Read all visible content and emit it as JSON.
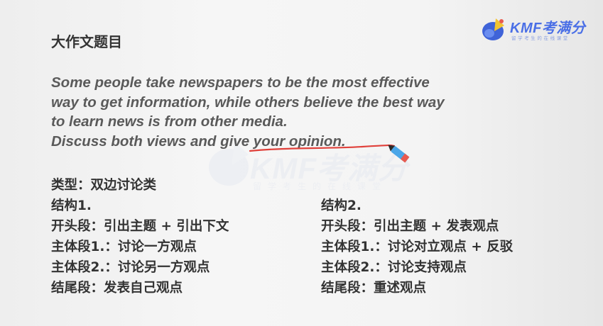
{
  "brand": {
    "name": "KMF考满分",
    "tagline": "留学考生的在线课堂"
  },
  "slide": {
    "title": "大作文题目",
    "prompt_lines": [
      "Some people take newspapers to be the most effective",
      "way to get information, while others believe the best way",
      "to learn news is from other media.",
      "Discuss both views and give your opinion."
    ],
    "left_column": [
      "类型：双边讨论类",
      "结构1.",
      "开头段：引出主题 + 引出下文",
      "主体段1.：讨论一方观点",
      "主体段2.：讨论另一方观点",
      "结尾段：发表自己观点"
    ],
    "right_column": [
      "结构2.",
      "开头段：引出主题 + 发表观点",
      "主体段1.：讨论对立观点 + 反驳",
      "主体段2.：讨论支持观点",
      "结尾段：重述观点"
    ]
  },
  "colors": {
    "accent": "#4a6fe6",
    "underline": "#e0403a",
    "pen_blue": "#4aa6e8"
  }
}
